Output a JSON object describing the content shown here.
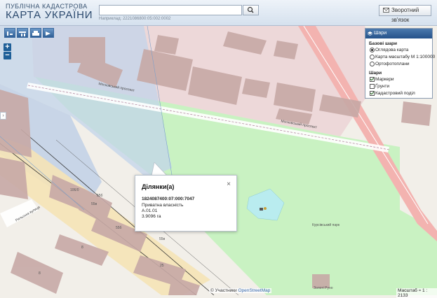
{
  "header": {
    "logo_line1": "ПУБЛІЧНА КАДАСТРОВА",
    "logo_line2": "КАРТА УКРАЇНИ",
    "search_hint": "Наприклад: 2221086800:05:002:0002",
    "feedback_label": "Зворотний зв'язок"
  },
  "layers_panel": {
    "title": "Шари",
    "base_section": "Базові шари",
    "base_items": [
      {
        "label": "Оглядова карта",
        "selected": true
      },
      {
        "label": "Карта масштабу М 1:100000",
        "selected": false
      },
      {
        "label": "Ортофотоплани",
        "selected": false
      }
    ],
    "layers_section": "Шари",
    "layer_items": [
      {
        "label": "Маркери",
        "checked": true
      },
      {
        "label": "Ґрунти",
        "checked": false
      },
      {
        "label": "Кадастровий поділ",
        "checked": true
      }
    ]
  },
  "popup": {
    "title": "Ділянки(а)",
    "close": "×",
    "cadastral_number": "1824087400:07:000:7047",
    "ownership": "Приватна власність",
    "code": "А.01.01",
    "area": "3.9096 га"
  },
  "map": {
    "street1": "Московський проспект",
    "street2": "Московський проспект",
    "street3": "Рильська вулиця",
    "park_label": "Курсівський парк",
    "building_label": "Золоті Руно",
    "house_numbers": [
      "106/0",
      "55б",
      "55б",
      "55в",
      "8",
      "8",
      "25",
      "55в"
    ],
    "attribution_prefix": "© Участники",
    "attribution_link": "OpenStreetMap",
    "scale": "Масштаб ≈ 1 : 2133"
  },
  "colors": {
    "header_text": "#2c4a6e",
    "park_green": "#c9f2c2",
    "main_road": "#f4a3a0",
    "cadastral_pink": "#ecd3d6",
    "cadastral_blue": "#c2d4ea",
    "accent": "#25528a"
  },
  "icons": {
    "search": "magnifier-icon",
    "feedback": "mail-icon",
    "zoom_in": "plus-icon",
    "zoom_out": "minus-icon"
  }
}
